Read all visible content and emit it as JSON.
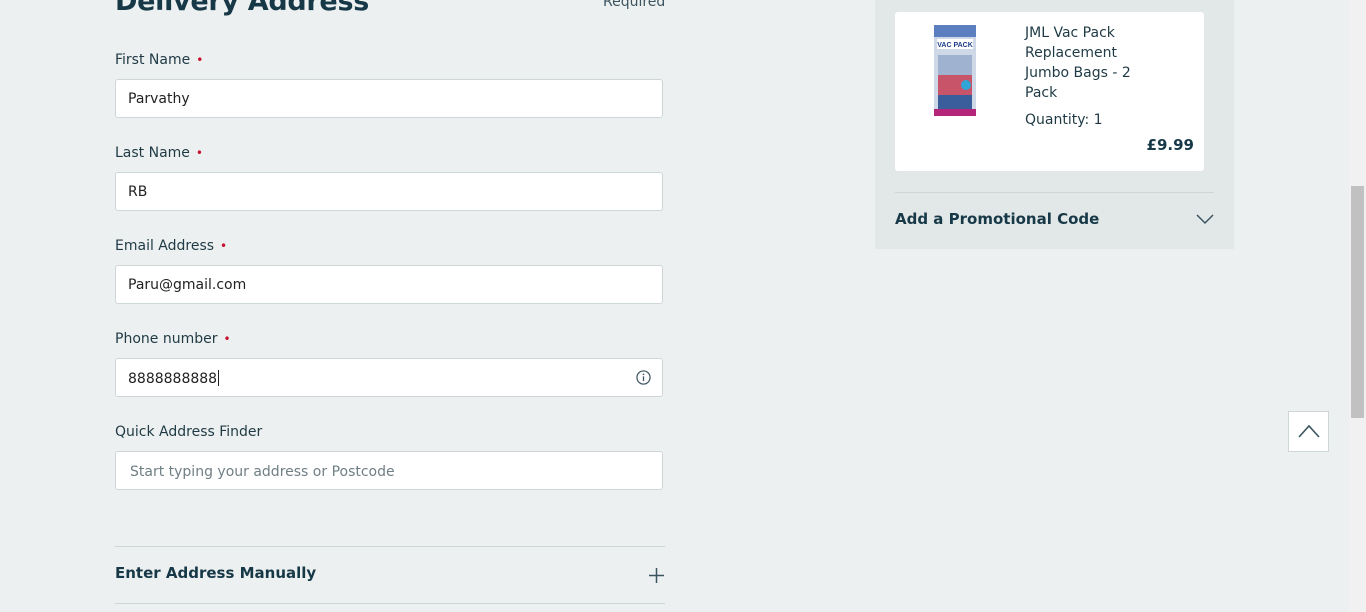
{
  "form": {
    "title": "Delivery Address",
    "required_note": "Required",
    "required_marker": "•",
    "first_name": {
      "label": "First Name",
      "value": "Parvathy"
    },
    "last_name": {
      "label": "Last Name",
      "value": "RB"
    },
    "email": {
      "label": "Email Address",
      "value": "Paru@gmail.com"
    },
    "phone": {
      "label": "Phone number",
      "value": "8888888888",
      "icon": "info-icon"
    },
    "address_finder": {
      "label": "Quick Address Finder",
      "placeholder": "Start typing your address or Postcode"
    },
    "manual_entry": {
      "label": "Enter Address Manually",
      "icon": "plus-icon"
    }
  },
  "order_summary": {
    "product": {
      "name": "JML Vac Pack Replacement Jumbo Bags - 2 Pack",
      "quantity": "Quantity: 1",
      "price": "£9.99",
      "image_text": "VAC PACK"
    },
    "promo": {
      "label": "Add a Promotional Code",
      "icon": "chevron-down-icon"
    }
  },
  "colors": {
    "page_background": "#edf0f0",
    "heading": "#163847",
    "required_dot": "#c8102e",
    "panel_background": "#e2e7e8"
  }
}
